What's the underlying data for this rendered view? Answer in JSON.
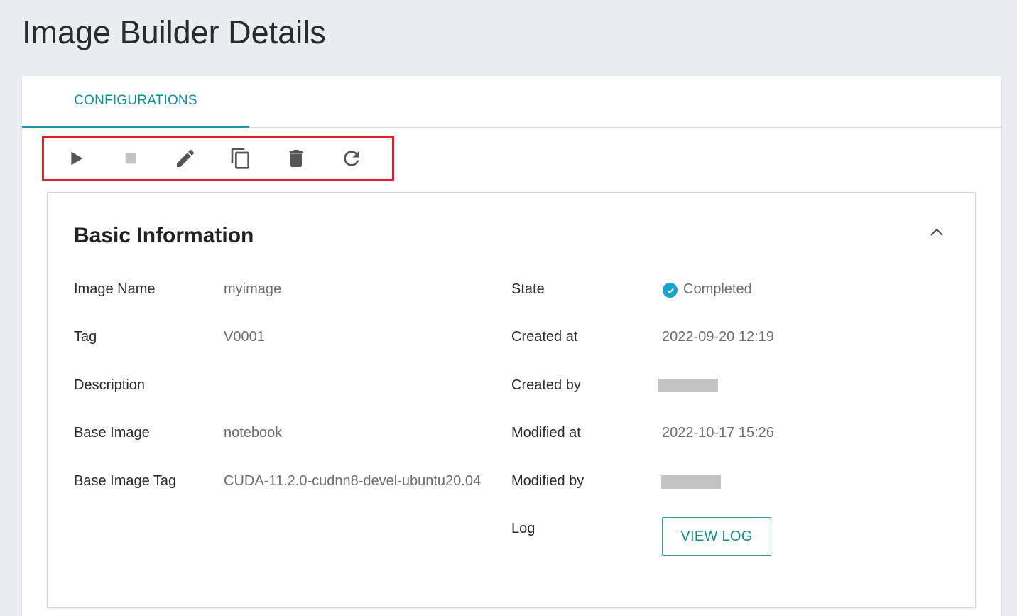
{
  "page": {
    "title": "Image Builder Details"
  },
  "tabs": [
    {
      "label": "CONFIGURATIONS"
    }
  ],
  "toolbar": {
    "icons": [
      "play-icon",
      "stop-icon",
      "edit-icon",
      "copy-icon",
      "delete-icon",
      "refresh-icon"
    ]
  },
  "basic_info": {
    "title": "Basic Information",
    "left": [
      {
        "label": "Image Name",
        "value": "myimage"
      },
      {
        "label": "Tag",
        "value": "V0001"
      },
      {
        "label": "Description",
        "value": ""
      },
      {
        "label": "Base Image",
        "value": "notebook"
      },
      {
        "label": "Base Image Tag",
        "value": "CUDA-11.2.0-cudnn8-devel-ubuntu20.04"
      }
    ],
    "right": [
      {
        "label": "State",
        "value": "Completed"
      },
      {
        "label": "Created at",
        "value": "2022-09-20 12:19"
      },
      {
        "label": "Created by",
        "value": ""
      },
      {
        "label": "Modified at",
        "value": "2022-10-17 15:26"
      },
      {
        "label": "Modified by",
        "value": ""
      },
      {
        "label": "Log",
        "value": "VIEW LOG"
      }
    ]
  },
  "colors": {
    "accent": "#0f8f9a",
    "highlight_border": "#e0202a",
    "status_completed": "#1aa3cc"
  }
}
